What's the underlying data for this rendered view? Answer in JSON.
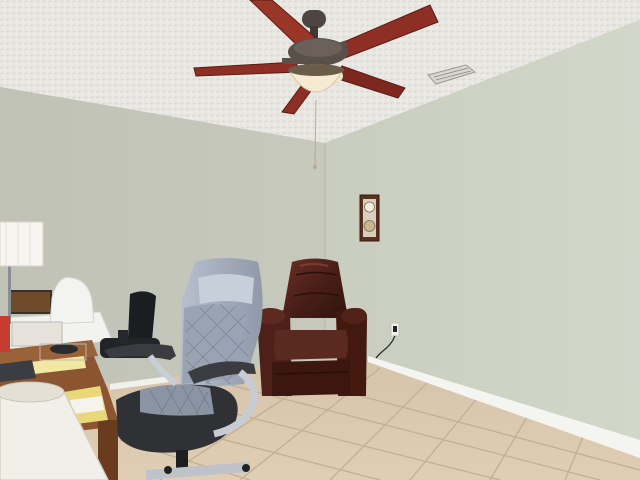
{
  "scene": {
    "kind": "photo",
    "room": "home office",
    "palette": {
      "ceiling": "#e9e7e2",
      "wall_left": "#c3c6b9",
      "wall_right": "#ccd1c4",
      "floor_tile": "#d8c6ad",
      "grout": "#c4ae92",
      "baseboard": "#f4f4f0",
      "fan_blade": "#8e2f25",
      "fan_metal": "#4d4540",
      "recliner": "#4a1f18",
      "office_chair_back": "#a9b3c3",
      "office_chair_seat": "#2f3135",
      "desk_wood": "#7a4a28"
    },
    "objects": [
      "ceiling-fan",
      "ceiling-vent",
      "wall-clock",
      "leather-recliner",
      "office-chair",
      "task-chair",
      "desk",
      "table-lamp",
      "lampshade-foreground",
      "wall-outlet",
      "tile-floor"
    ]
  }
}
